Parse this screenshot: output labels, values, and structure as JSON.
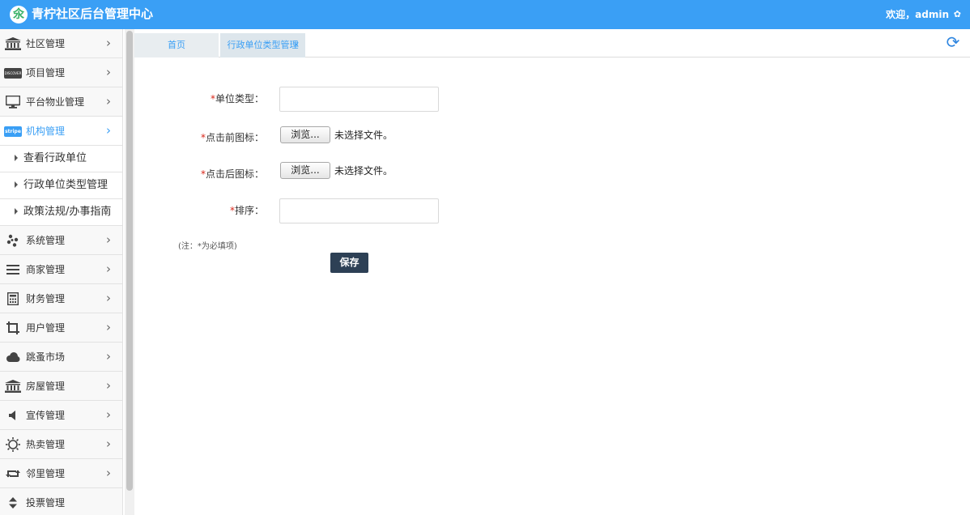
{
  "header": {
    "logo_glyph": "氽",
    "title": "青柠社区后台管理中心",
    "welcome": "欢迎，admin",
    "bg_color": "#3a9ff5"
  },
  "sidebar": {
    "items": [
      {
        "label": "社区管理",
        "icon": "bank-icon"
      },
      {
        "label": "项目管理",
        "icon": "discover-card-icon",
        "icon_text": "DISCOVER"
      },
      {
        "label": "平台物业管理",
        "icon": "monitor-icon"
      },
      {
        "label": "机构管理",
        "icon": "stripe-icon",
        "icon_text": "stripe",
        "active": true
      },
      {
        "label": "系统管理",
        "icon": "yelp-icon"
      },
      {
        "label": "商家管理",
        "icon": "list-icon"
      },
      {
        "label": "财务管理",
        "icon": "calculator-icon"
      },
      {
        "label": "用户管理",
        "icon": "crop-icon"
      },
      {
        "label": "跳蚤市场",
        "icon": "cloud-icon"
      },
      {
        "label": "房屋管理",
        "icon": "bank-icon"
      },
      {
        "label": "宣传管理",
        "icon": "volume-icon"
      },
      {
        "label": "热卖管理",
        "icon": "sun-icon"
      },
      {
        "label": "邻里管理",
        "icon": "retweet-icon"
      },
      {
        "label": "投票管理",
        "icon": "sort-icon"
      }
    ],
    "submenu": [
      {
        "label": "查看行政单位"
      },
      {
        "label": "行政单位类型管理"
      },
      {
        "label": "政策法规/办事指南"
      }
    ]
  },
  "tabs": {
    "home": "首页",
    "current": "行政单位类型管理",
    "close": "×"
  },
  "form": {
    "required_mark": "*",
    "unit_type_label": "单位类型：",
    "before_icon_label": "点击前图标：",
    "after_icon_label": "点击后图标：",
    "sort_label": "排序：",
    "browse_label": "浏览...",
    "no_file_text": "未选择文件。",
    "note": "(注：*为必填项)",
    "save_label": "保存"
  }
}
